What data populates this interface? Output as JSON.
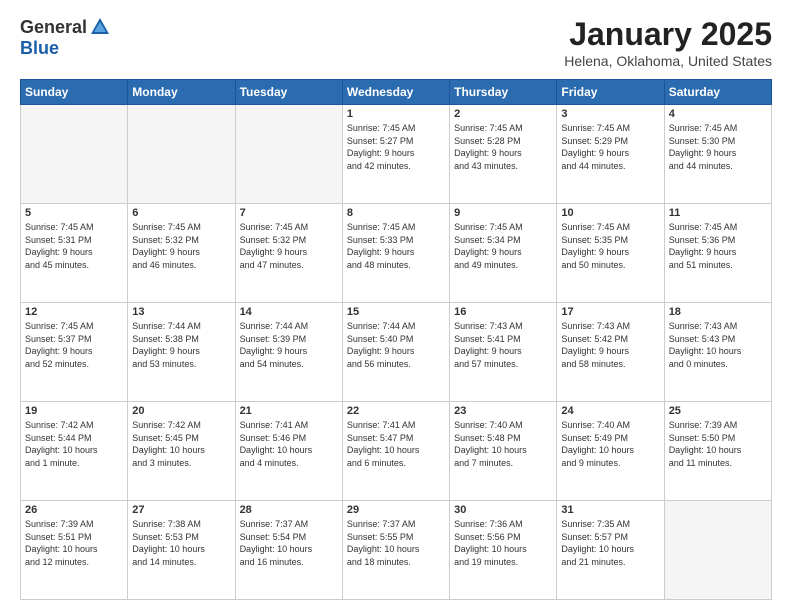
{
  "logo": {
    "general": "General",
    "blue": "Blue"
  },
  "title": "January 2025",
  "location": "Helena, Oklahoma, United States",
  "days_header": [
    "Sunday",
    "Monday",
    "Tuesday",
    "Wednesday",
    "Thursday",
    "Friday",
    "Saturday"
  ],
  "weeks": [
    [
      {
        "num": "",
        "info": ""
      },
      {
        "num": "",
        "info": ""
      },
      {
        "num": "",
        "info": ""
      },
      {
        "num": "1",
        "info": "Sunrise: 7:45 AM\nSunset: 5:27 PM\nDaylight: 9 hours\nand 42 minutes."
      },
      {
        "num": "2",
        "info": "Sunrise: 7:45 AM\nSunset: 5:28 PM\nDaylight: 9 hours\nand 43 minutes."
      },
      {
        "num": "3",
        "info": "Sunrise: 7:45 AM\nSunset: 5:29 PM\nDaylight: 9 hours\nand 44 minutes."
      },
      {
        "num": "4",
        "info": "Sunrise: 7:45 AM\nSunset: 5:30 PM\nDaylight: 9 hours\nand 44 minutes."
      }
    ],
    [
      {
        "num": "5",
        "info": "Sunrise: 7:45 AM\nSunset: 5:31 PM\nDaylight: 9 hours\nand 45 minutes."
      },
      {
        "num": "6",
        "info": "Sunrise: 7:45 AM\nSunset: 5:32 PM\nDaylight: 9 hours\nand 46 minutes."
      },
      {
        "num": "7",
        "info": "Sunrise: 7:45 AM\nSunset: 5:32 PM\nDaylight: 9 hours\nand 47 minutes."
      },
      {
        "num": "8",
        "info": "Sunrise: 7:45 AM\nSunset: 5:33 PM\nDaylight: 9 hours\nand 48 minutes."
      },
      {
        "num": "9",
        "info": "Sunrise: 7:45 AM\nSunset: 5:34 PM\nDaylight: 9 hours\nand 49 minutes."
      },
      {
        "num": "10",
        "info": "Sunrise: 7:45 AM\nSunset: 5:35 PM\nDaylight: 9 hours\nand 50 minutes."
      },
      {
        "num": "11",
        "info": "Sunrise: 7:45 AM\nSunset: 5:36 PM\nDaylight: 9 hours\nand 51 minutes."
      }
    ],
    [
      {
        "num": "12",
        "info": "Sunrise: 7:45 AM\nSunset: 5:37 PM\nDaylight: 9 hours\nand 52 minutes."
      },
      {
        "num": "13",
        "info": "Sunrise: 7:44 AM\nSunset: 5:38 PM\nDaylight: 9 hours\nand 53 minutes."
      },
      {
        "num": "14",
        "info": "Sunrise: 7:44 AM\nSunset: 5:39 PM\nDaylight: 9 hours\nand 54 minutes."
      },
      {
        "num": "15",
        "info": "Sunrise: 7:44 AM\nSunset: 5:40 PM\nDaylight: 9 hours\nand 56 minutes."
      },
      {
        "num": "16",
        "info": "Sunrise: 7:43 AM\nSunset: 5:41 PM\nDaylight: 9 hours\nand 57 minutes."
      },
      {
        "num": "17",
        "info": "Sunrise: 7:43 AM\nSunset: 5:42 PM\nDaylight: 9 hours\nand 58 minutes."
      },
      {
        "num": "18",
        "info": "Sunrise: 7:43 AM\nSunset: 5:43 PM\nDaylight: 10 hours\nand 0 minutes."
      }
    ],
    [
      {
        "num": "19",
        "info": "Sunrise: 7:42 AM\nSunset: 5:44 PM\nDaylight: 10 hours\nand 1 minute."
      },
      {
        "num": "20",
        "info": "Sunrise: 7:42 AM\nSunset: 5:45 PM\nDaylight: 10 hours\nand 3 minutes."
      },
      {
        "num": "21",
        "info": "Sunrise: 7:41 AM\nSunset: 5:46 PM\nDaylight: 10 hours\nand 4 minutes."
      },
      {
        "num": "22",
        "info": "Sunrise: 7:41 AM\nSunset: 5:47 PM\nDaylight: 10 hours\nand 6 minutes."
      },
      {
        "num": "23",
        "info": "Sunrise: 7:40 AM\nSunset: 5:48 PM\nDaylight: 10 hours\nand 7 minutes."
      },
      {
        "num": "24",
        "info": "Sunrise: 7:40 AM\nSunset: 5:49 PM\nDaylight: 10 hours\nand 9 minutes."
      },
      {
        "num": "25",
        "info": "Sunrise: 7:39 AM\nSunset: 5:50 PM\nDaylight: 10 hours\nand 11 minutes."
      }
    ],
    [
      {
        "num": "26",
        "info": "Sunrise: 7:39 AM\nSunset: 5:51 PM\nDaylight: 10 hours\nand 12 minutes."
      },
      {
        "num": "27",
        "info": "Sunrise: 7:38 AM\nSunset: 5:53 PM\nDaylight: 10 hours\nand 14 minutes."
      },
      {
        "num": "28",
        "info": "Sunrise: 7:37 AM\nSunset: 5:54 PM\nDaylight: 10 hours\nand 16 minutes."
      },
      {
        "num": "29",
        "info": "Sunrise: 7:37 AM\nSunset: 5:55 PM\nDaylight: 10 hours\nand 18 minutes."
      },
      {
        "num": "30",
        "info": "Sunrise: 7:36 AM\nSunset: 5:56 PM\nDaylight: 10 hours\nand 19 minutes."
      },
      {
        "num": "31",
        "info": "Sunrise: 7:35 AM\nSunset: 5:57 PM\nDaylight: 10 hours\nand 21 minutes."
      },
      {
        "num": "",
        "info": ""
      }
    ]
  ]
}
